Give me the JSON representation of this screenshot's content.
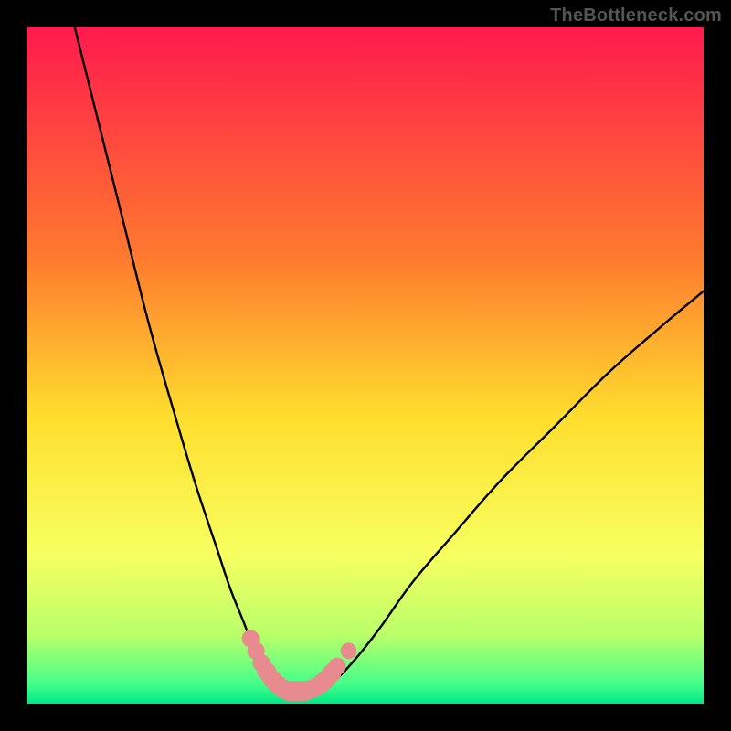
{
  "watermark": "TheBottleneck.com",
  "chart_data": {
    "type": "line",
    "title": "",
    "xlabel": "",
    "ylabel": "",
    "xlim": [
      0,
      100
    ],
    "ylim": [
      0,
      100
    ],
    "gradient_stops": [
      {
        "pos": 0,
        "color": "#ff1a4e"
      },
      {
        "pos": 0.34,
        "color": "#ff7a2e"
      },
      {
        "pos": 0.58,
        "color": "#ffdf2e"
      },
      {
        "pos": 0.78,
        "color": "#f7ff60"
      },
      {
        "pos": 0.9,
        "color": "#b8ff6a"
      },
      {
        "pos": 0.97,
        "color": "#46ff8a"
      },
      {
        "pos": 1.0,
        "color": "#00e884"
      }
    ],
    "series": [
      {
        "name": "left-curve",
        "stroke": "#000000",
        "stroke_width": 2.4,
        "points": [
          {
            "x": 7,
            "y": 100
          },
          {
            "x": 10,
            "y": 88
          },
          {
            "x": 14,
            "y": 72
          },
          {
            "x": 18,
            "y": 56
          },
          {
            "x": 22,
            "y": 42
          },
          {
            "x": 25,
            "y": 32
          },
          {
            "x": 28,
            "y": 23
          },
          {
            "x": 30,
            "y": 17
          },
          {
            "x": 32,
            "y": 12
          },
          {
            "x": 33.5,
            "y": 8
          },
          {
            "x": 35,
            "y": 5
          },
          {
            "x": 36.5,
            "y": 3
          },
          {
            "x": 38,
            "y": 2
          }
        ]
      },
      {
        "name": "right-curve",
        "stroke": "#000000",
        "stroke_width": 2.4,
        "points": [
          {
            "x": 43,
            "y": 2
          },
          {
            "x": 45,
            "y": 3
          },
          {
            "x": 48,
            "y": 6
          },
          {
            "x": 52,
            "y": 11
          },
          {
            "x": 57,
            "y": 18
          },
          {
            "x": 63,
            "y": 25
          },
          {
            "x": 70,
            "y": 33
          },
          {
            "x": 78,
            "y": 41
          },
          {
            "x": 86,
            "y": 49
          },
          {
            "x": 94,
            "y": 56
          },
          {
            "x": 100,
            "y": 61
          }
        ]
      }
    ],
    "marker_series": {
      "name": "pink-markers",
      "color": "#e78b8e",
      "points": [
        {
          "x": 33,
          "y": 9.6,
          "r": 1.3
        },
        {
          "x": 33.8,
          "y": 7.8,
          "r": 1.3
        },
        {
          "x": 34.6,
          "y": 6.0,
          "r": 1.3
        },
        {
          "x": 35.4,
          "y": 4.7,
          "r": 1.4
        },
        {
          "x": 36.2,
          "y": 3.6,
          "r": 1.4
        },
        {
          "x": 37.0,
          "y": 2.8,
          "r": 1.4
        },
        {
          "x": 37.8,
          "y": 2.2,
          "r": 1.4
        },
        {
          "x": 38.6,
          "y": 1.9,
          "r": 1.5
        },
        {
          "x": 39.4,
          "y": 1.85,
          "r": 1.5
        },
        {
          "x": 40.2,
          "y": 1.85,
          "r": 1.5
        },
        {
          "x": 41.0,
          "y": 1.9,
          "r": 1.5
        },
        {
          "x": 41.8,
          "y": 2.1,
          "r": 1.4
        },
        {
          "x": 42.6,
          "y": 2.4,
          "r": 1.4
        },
        {
          "x": 43.4,
          "y": 2.9,
          "r": 1.4
        },
        {
          "x": 44.2,
          "y": 3.6,
          "r": 1.4
        },
        {
          "x": 45.0,
          "y": 4.5,
          "r": 1.4
        },
        {
          "x": 45.8,
          "y": 5.5,
          "r": 1.3
        },
        {
          "x": 47.5,
          "y": 7.8,
          "r": 1.2
        }
      ]
    }
  }
}
